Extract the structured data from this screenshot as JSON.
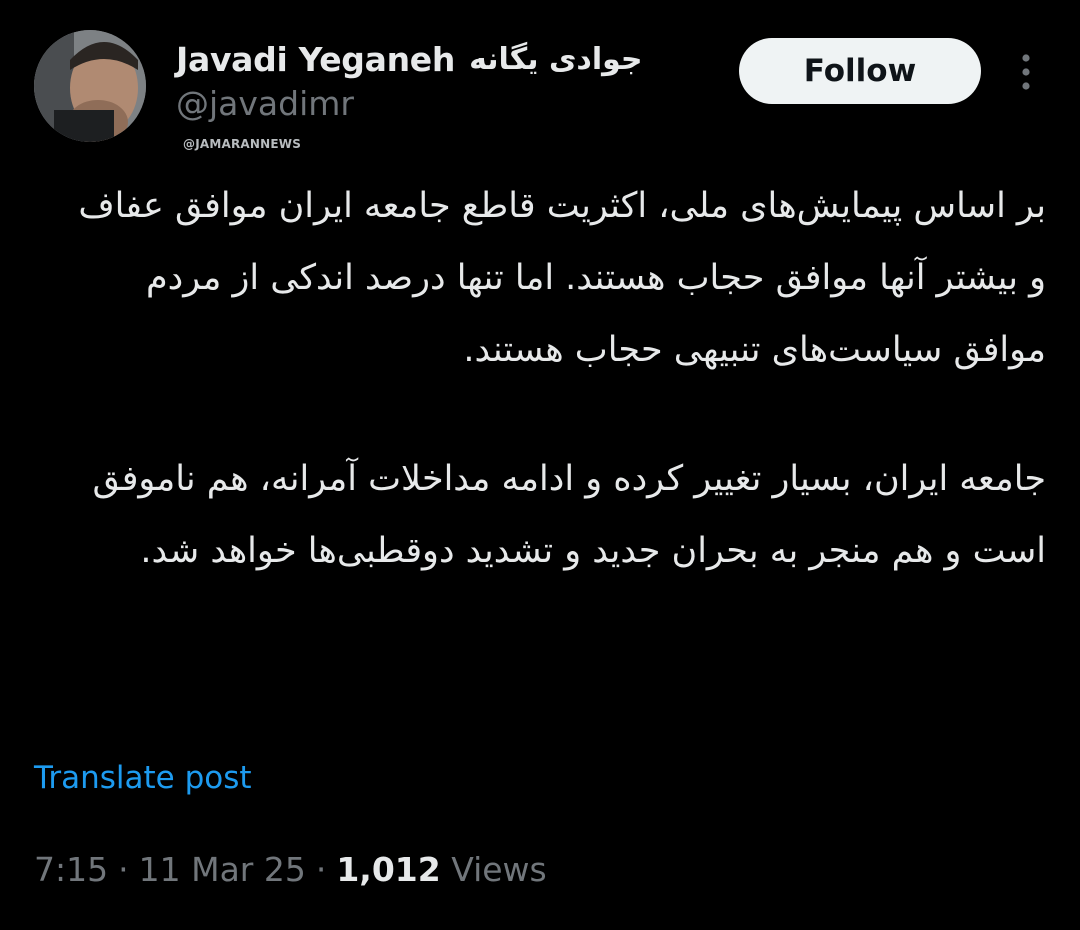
{
  "author": {
    "display_name": "Javadi Yeganeh",
    "display_name_fa": "جوادی یگانه",
    "handle": "@javadimr"
  },
  "watermark": "@JAMARANNEWS",
  "follow_button": {
    "label": "Follow"
  },
  "more_button": {
    "icon": "more-vertical-icon"
  },
  "post": {
    "paragraph_1": "بر اساس پیمایش‌های ملی، اکثریت قاطع جامعه ایران موافق عفاف و بیشتر آنها موافق حجاب هستند. اما تنها درصد اندکی از مردم موافق سیاست‌های تنبیهی حجاب هستند.",
    "paragraph_2": "جامعه ایران، بسیار تغییر کرده و ادامه مداخلات آمرانه، هم ناموفق است و هم منجر به بحران جدید و تشدید دوقطبی‌ها خواهد شد."
  },
  "translate_link": "Translate post",
  "meta": {
    "time": "7:15",
    "date": "11 Mar 25",
    "views_count": "1,012",
    "views_label": "Views",
    "separator": "·"
  },
  "colors": {
    "background": "#000000",
    "text_primary": "#e7e9ea",
    "text_secondary": "#71767b",
    "link": "#1d9bf0",
    "follow_bg": "#eff3f4"
  }
}
